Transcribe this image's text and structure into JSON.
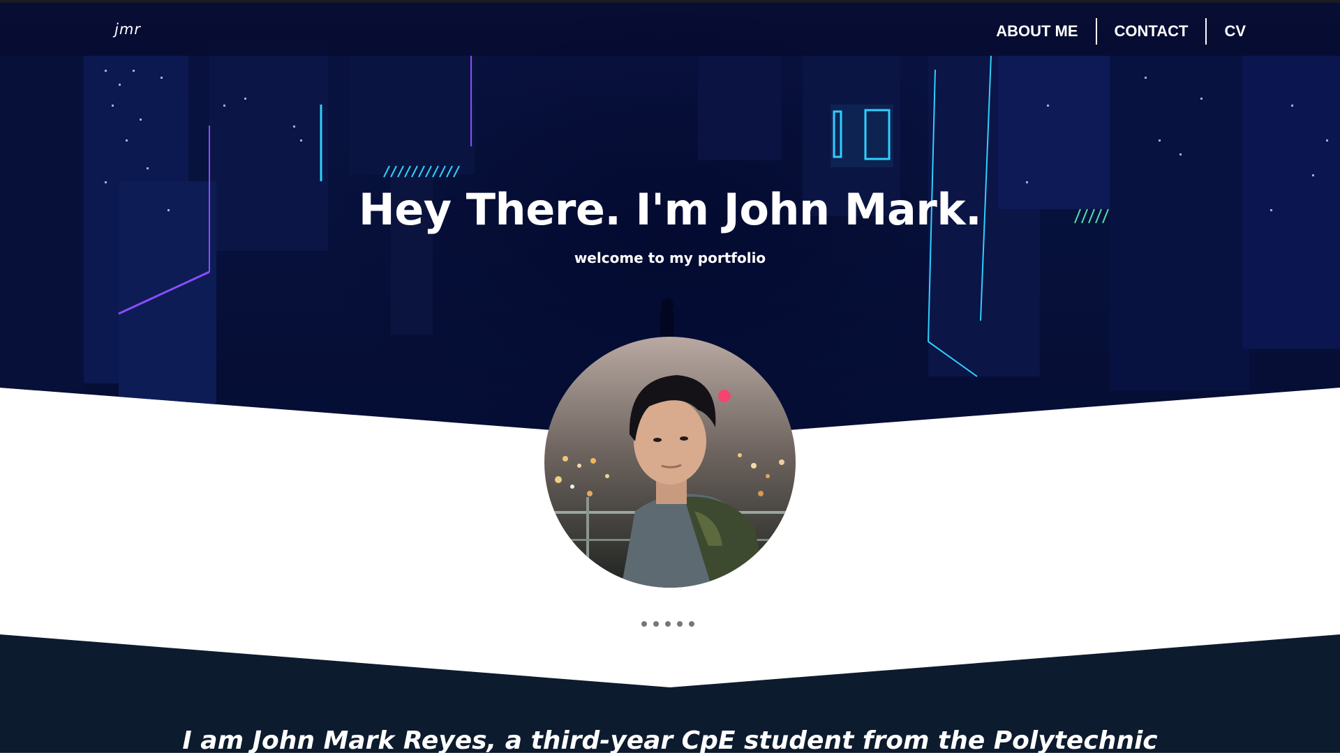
{
  "header": {
    "logo": "jmr",
    "nav": [
      {
        "label": "ABOUT ME"
      },
      {
        "label": "CONTACT"
      },
      {
        "label": "CV"
      }
    ]
  },
  "hero": {
    "title": "Hey There. I'm John Mark.",
    "subtitle": "welcome to my portfolio"
  },
  "carousel": {
    "dot_count": 5
  },
  "about": {
    "intro": "I am John Mark Reyes, a third-year CpE student from the Polytechnic"
  },
  "colors": {
    "hero_bg": "#07123d",
    "section_bg": "#0d1b2e",
    "text": "#ffffff",
    "neon_cyan": "#2fd0ff",
    "neon_purple": "#8a4dff"
  }
}
